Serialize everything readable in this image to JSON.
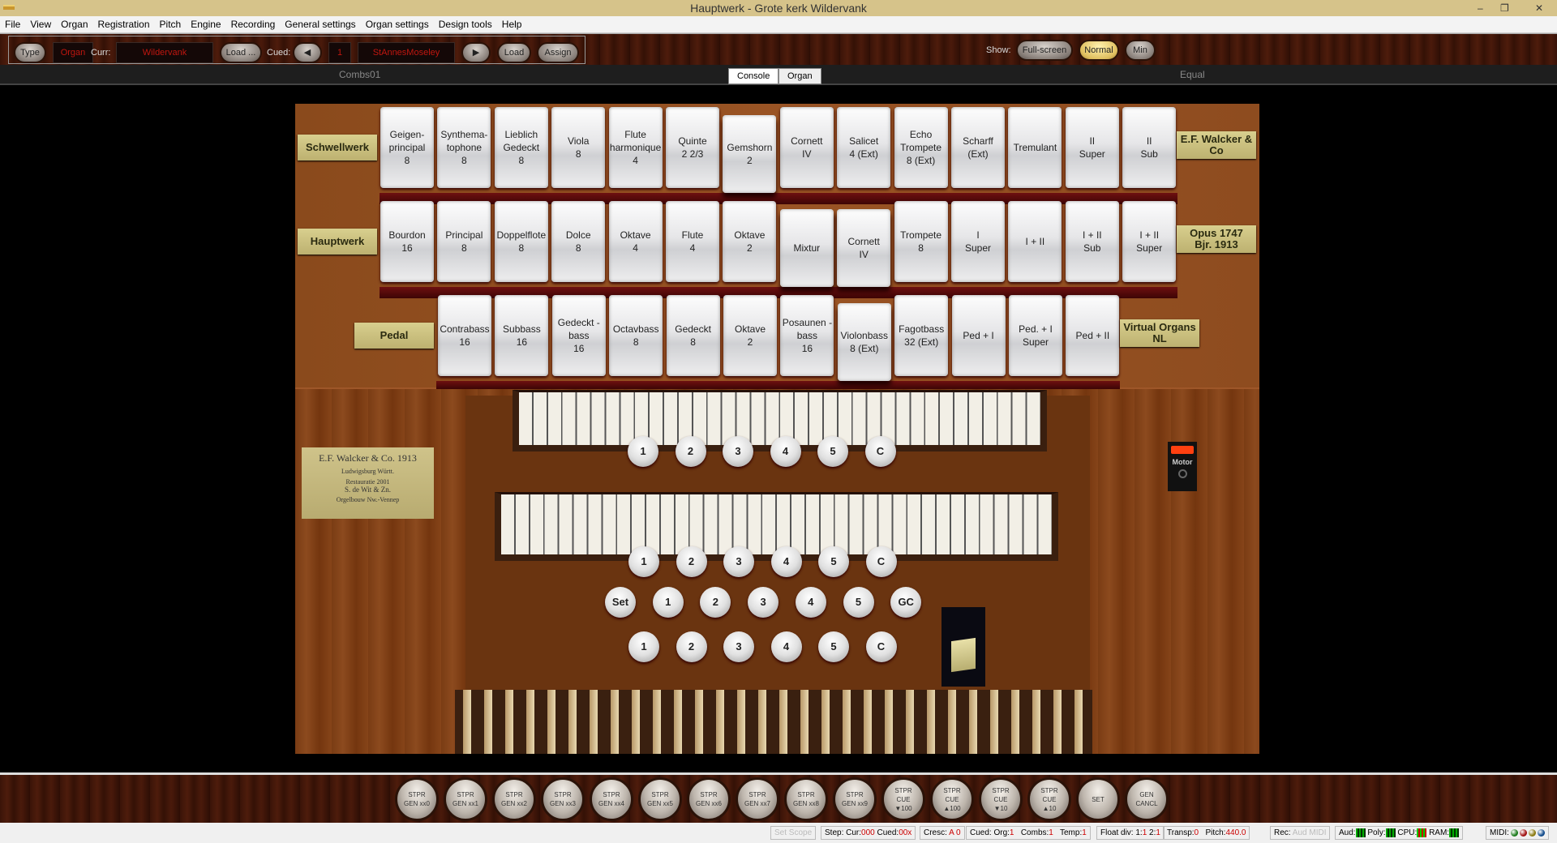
{
  "window": {
    "title": "Hauptwerk - Grote kerk Wildervank",
    "min": "–",
    "max": "❐",
    "close": "✕"
  },
  "menu": [
    "File",
    "View",
    "Organ",
    "Registration",
    "Pitch",
    "Engine",
    "Recording",
    "General settings",
    "Organ settings",
    "Design tools",
    "Help"
  ],
  "toolbar": {
    "type": "Type",
    "type_value": "Organ",
    "curr_label": "Curr:",
    "curr_value": "Wildervank",
    "load_dots": "Load ...",
    "cued_label": "Cued:",
    "cued_number": "1",
    "cued_value": "StAnnesMoseley",
    "load": "Load",
    "assign": "Assign",
    "show_label": "Show:",
    "show_fullscreen": "Full-screen",
    "show_normal": "Normal",
    "show_min": "Min",
    "show_selected": "Normal"
  },
  "tabs": {
    "left_info": "Combs01",
    "right_info": "Equal",
    "items": [
      "Console",
      "Organ"
    ],
    "active": "Console"
  },
  "divisions": {
    "row1": {
      "label": "Schwellwerk",
      "right_plate": "E.F. Walcker &\nCo",
      "stops": [
        {
          "label": "Geigen-\nprincipal\n8",
          "on": false
        },
        {
          "label": "Synthema-\ntophone\n8",
          "on": false
        },
        {
          "label": "Lieblich\nGedeckt\n8",
          "on": false
        },
        {
          "label": "Viola\n8",
          "on": false
        },
        {
          "label": "Flute\nharmonique\n4",
          "on": false
        },
        {
          "label": "Quinte\n2 2/3",
          "on": false
        },
        {
          "label": "Gemshorn\n2",
          "on": true
        },
        {
          "label": "Cornett\nIV",
          "on": false
        },
        {
          "label": "Salicet\n4 (Ext)",
          "on": false
        },
        {
          "label": "Echo\nTrompete\n8 (Ext)",
          "on": false
        },
        {
          "label": "Scharff\n(Ext)",
          "on": false
        },
        {
          "label": "Tremulant",
          "on": false
        },
        {
          "label": "II\nSuper",
          "on": false
        },
        {
          "label": "II\nSub",
          "on": false
        }
      ]
    },
    "row2": {
      "label": "Hauptwerk",
      "right_plate": "Opus 1747\nBjr. 1913",
      "stops": [
        {
          "label": "Bourdon\n16",
          "on": false
        },
        {
          "label": "Principal\n8",
          "on": false
        },
        {
          "label": "Doppelflote\n8",
          "on": false
        },
        {
          "label": "Dolce\n8",
          "on": false
        },
        {
          "label": "Oktave\n4",
          "on": false
        },
        {
          "label": "Flute\n4",
          "on": false
        },
        {
          "label": "Oktave\n2",
          "on": false
        },
        {
          "label": "Mixtur",
          "on": true
        },
        {
          "label": "Cornett\nIV",
          "on": true
        },
        {
          "label": "Trompete\n8",
          "on": false
        },
        {
          "label": "I\nSuper",
          "on": false
        },
        {
          "label": "I + II",
          "on": false
        },
        {
          "label": "I + II\nSub",
          "on": false
        },
        {
          "label": "I + II\nSuper",
          "on": false
        }
      ]
    },
    "row3": {
      "label": "Pedal",
      "right_plate": "Virtual Organs\nNL",
      "stops": [
        {
          "label": "Contrabass\n16",
          "on": false
        },
        {
          "label": "Subbass\n16",
          "on": false
        },
        {
          "label": "Gedeckt -\nbass\n16",
          "on": false
        },
        {
          "label": "Octavbass\n8",
          "on": false
        },
        {
          "label": "Gedeckt\n8",
          "on": false
        },
        {
          "label": "Oktave\n2",
          "on": false
        },
        {
          "label": "Posaunen -\nbass\n16",
          "on": false
        },
        {
          "label": "Violonbass\n8 (Ext)",
          "on": true
        },
        {
          "label": "Fagotbass\n32 (Ext)",
          "on": false
        },
        {
          "label": "Ped + I",
          "on": false
        },
        {
          "label": "Ped. + I\nSuper",
          "on": false
        },
        {
          "label": "Ped + II",
          "on": false
        }
      ]
    }
  },
  "nameplate": [
    "E.F. Walcker & Co. 1913",
    "Ludwigsburg Württ.",
    "Restauratie 2001",
    "S. de Wit & Zn.",
    "Orgelbouw Nw.-Vennep"
  ],
  "motor": {
    "label": "Motor",
    "indicator_color": "#ff4010"
  },
  "pistons": {
    "upper": [
      "1",
      "2",
      "3",
      "4",
      "5",
      "C"
    ],
    "lower": [
      "1",
      "2",
      "3",
      "4",
      "5",
      "C"
    ],
    "general": [
      "Set",
      "1",
      "2",
      "3",
      "4",
      "5",
      "GC"
    ],
    "toe": [
      "1",
      "2",
      "3",
      "4",
      "5",
      "C"
    ]
  },
  "bottom_pistons": [
    "STPR\nGEN xx0",
    "STPR\nGEN xx1",
    "STPR\nGEN xx2",
    "STPR\nGEN xx3",
    "STPR\nGEN xx4",
    "STPR\nGEN xx5",
    "STPR\nGEN xx6",
    "STPR\nGEN xx7",
    "STPR\nGEN xx8",
    "STPR\nGEN xx9",
    "STPR\nCUE\n▼100",
    "STPR\nCUE\n▲100",
    "STPR\nCUE\n▼10",
    "STPR\nCUE\n▲10",
    "SET",
    "GEN\nCANCL"
  ],
  "status": {
    "set": "Set",
    "scope": "Scope",
    "step_label": "Step: Cur:",
    "step_cur": "000",
    "cued_label": "Cued:",
    "step_cued": "00x",
    "cresc_label": "Cresc:",
    "cresc": "A 0",
    "cued_org_label": "Cued: Org:",
    "cued_org": "1",
    "combs_label": "Combs:",
    "combs": "1",
    "temp_label": "Temp:",
    "temp": "1",
    "float_label": "Float div: 1:",
    "float1": "1",
    "float2_label": "2:",
    "float2": "1",
    "transp_label": "Transp:",
    "transp": "0",
    "pitch_label": "Pitch:",
    "pitch": "440.0",
    "rec_label": "Rec:",
    "rec_aud": "Aud",
    "rec_midi": "MIDI",
    "aud": "Aud:",
    "poly": "Poly:",
    "cpu": "CPU:",
    "ram": "RAM:",
    "midi": "MIDI:",
    "midi_leds": [
      "#1a7a1a",
      "#a01010",
      "#8a7a10",
      "#104a8a"
    ]
  }
}
